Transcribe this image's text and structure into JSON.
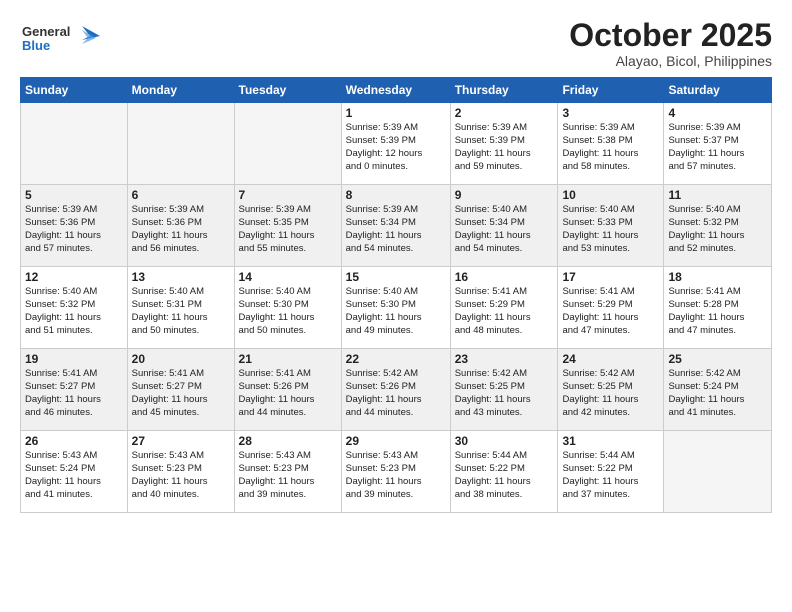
{
  "logo": {
    "general": "General",
    "blue": "Blue",
    "tagline": ""
  },
  "title": "October 2025",
  "subtitle": "Alayao, Bicol, Philippines",
  "weekdays": [
    "Sunday",
    "Monday",
    "Tuesday",
    "Wednesday",
    "Thursday",
    "Friday",
    "Saturday"
  ],
  "weeks": [
    [
      {
        "day": "",
        "content": ""
      },
      {
        "day": "",
        "content": ""
      },
      {
        "day": "",
        "content": ""
      },
      {
        "day": "1",
        "content": "Sunrise: 5:39 AM\nSunset: 5:39 PM\nDaylight: 12 hours\nand 0 minutes."
      },
      {
        "day": "2",
        "content": "Sunrise: 5:39 AM\nSunset: 5:39 PM\nDaylight: 11 hours\nand 59 minutes."
      },
      {
        "day": "3",
        "content": "Sunrise: 5:39 AM\nSunset: 5:38 PM\nDaylight: 11 hours\nand 58 minutes."
      },
      {
        "day": "4",
        "content": "Sunrise: 5:39 AM\nSunset: 5:37 PM\nDaylight: 11 hours\nand 57 minutes."
      }
    ],
    [
      {
        "day": "5",
        "content": "Sunrise: 5:39 AM\nSunset: 5:36 PM\nDaylight: 11 hours\nand 57 minutes."
      },
      {
        "day": "6",
        "content": "Sunrise: 5:39 AM\nSunset: 5:36 PM\nDaylight: 11 hours\nand 56 minutes."
      },
      {
        "day": "7",
        "content": "Sunrise: 5:39 AM\nSunset: 5:35 PM\nDaylight: 11 hours\nand 55 minutes."
      },
      {
        "day": "8",
        "content": "Sunrise: 5:39 AM\nSunset: 5:34 PM\nDaylight: 11 hours\nand 54 minutes."
      },
      {
        "day": "9",
        "content": "Sunrise: 5:40 AM\nSunset: 5:34 PM\nDaylight: 11 hours\nand 54 minutes."
      },
      {
        "day": "10",
        "content": "Sunrise: 5:40 AM\nSunset: 5:33 PM\nDaylight: 11 hours\nand 53 minutes."
      },
      {
        "day": "11",
        "content": "Sunrise: 5:40 AM\nSunset: 5:32 PM\nDaylight: 11 hours\nand 52 minutes."
      }
    ],
    [
      {
        "day": "12",
        "content": "Sunrise: 5:40 AM\nSunset: 5:32 PM\nDaylight: 11 hours\nand 51 minutes."
      },
      {
        "day": "13",
        "content": "Sunrise: 5:40 AM\nSunset: 5:31 PM\nDaylight: 11 hours\nand 50 minutes."
      },
      {
        "day": "14",
        "content": "Sunrise: 5:40 AM\nSunset: 5:30 PM\nDaylight: 11 hours\nand 50 minutes."
      },
      {
        "day": "15",
        "content": "Sunrise: 5:40 AM\nSunset: 5:30 PM\nDaylight: 11 hours\nand 49 minutes."
      },
      {
        "day": "16",
        "content": "Sunrise: 5:41 AM\nSunset: 5:29 PM\nDaylight: 11 hours\nand 48 minutes."
      },
      {
        "day": "17",
        "content": "Sunrise: 5:41 AM\nSunset: 5:29 PM\nDaylight: 11 hours\nand 47 minutes."
      },
      {
        "day": "18",
        "content": "Sunrise: 5:41 AM\nSunset: 5:28 PM\nDaylight: 11 hours\nand 47 minutes."
      }
    ],
    [
      {
        "day": "19",
        "content": "Sunrise: 5:41 AM\nSunset: 5:27 PM\nDaylight: 11 hours\nand 46 minutes."
      },
      {
        "day": "20",
        "content": "Sunrise: 5:41 AM\nSunset: 5:27 PM\nDaylight: 11 hours\nand 45 minutes."
      },
      {
        "day": "21",
        "content": "Sunrise: 5:41 AM\nSunset: 5:26 PM\nDaylight: 11 hours\nand 44 minutes."
      },
      {
        "day": "22",
        "content": "Sunrise: 5:42 AM\nSunset: 5:26 PM\nDaylight: 11 hours\nand 44 minutes."
      },
      {
        "day": "23",
        "content": "Sunrise: 5:42 AM\nSunset: 5:25 PM\nDaylight: 11 hours\nand 43 minutes."
      },
      {
        "day": "24",
        "content": "Sunrise: 5:42 AM\nSunset: 5:25 PM\nDaylight: 11 hours\nand 42 minutes."
      },
      {
        "day": "25",
        "content": "Sunrise: 5:42 AM\nSunset: 5:24 PM\nDaylight: 11 hours\nand 41 minutes."
      }
    ],
    [
      {
        "day": "26",
        "content": "Sunrise: 5:43 AM\nSunset: 5:24 PM\nDaylight: 11 hours\nand 41 minutes."
      },
      {
        "day": "27",
        "content": "Sunrise: 5:43 AM\nSunset: 5:23 PM\nDaylight: 11 hours\nand 40 minutes."
      },
      {
        "day": "28",
        "content": "Sunrise: 5:43 AM\nSunset: 5:23 PM\nDaylight: 11 hours\nand 39 minutes."
      },
      {
        "day": "29",
        "content": "Sunrise: 5:43 AM\nSunset: 5:23 PM\nDaylight: 11 hours\nand 39 minutes."
      },
      {
        "day": "30",
        "content": "Sunrise: 5:44 AM\nSunset: 5:22 PM\nDaylight: 11 hours\nand 38 minutes."
      },
      {
        "day": "31",
        "content": "Sunrise: 5:44 AM\nSunset: 5:22 PM\nDaylight: 11 hours\nand 37 minutes."
      },
      {
        "day": "",
        "content": ""
      }
    ]
  ]
}
